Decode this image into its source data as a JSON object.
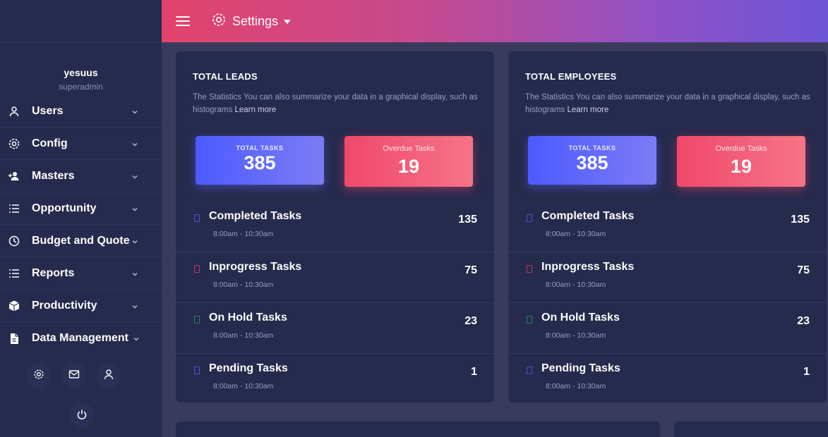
{
  "user": {
    "name": "yesuus",
    "role": "superadmin"
  },
  "sidebar": {
    "items": [
      {
        "label": "Users",
        "icon": "user-icon"
      },
      {
        "label": "Config",
        "icon": "gear-icon"
      },
      {
        "label": "Masters",
        "icon": "user-plus-icon"
      },
      {
        "label": "Opportunity",
        "icon": "list-icon"
      },
      {
        "label": "Budget and Quote",
        "icon": "clock-icon"
      },
      {
        "label": "Reports",
        "icon": "list-icon"
      },
      {
        "label": "Productivity",
        "icon": "cube-icon"
      },
      {
        "label": "Data Management",
        "icon": "file-icon"
      }
    ],
    "bottom_icons": [
      "gear-icon",
      "mail-icon",
      "user-icon",
      "power-icon"
    ]
  },
  "header": {
    "settings_label": "Settings"
  },
  "cards": [
    {
      "title": "TOTAL LEADS",
      "description": "The Statistics You can also summarize your data in a graphical display, such as histograms",
      "learn_more": "Learn more",
      "total_label": "TOTAL TASKS",
      "total_value": "385",
      "overdue_label": "Overdue Tasks",
      "overdue_value": "19",
      "tasks": [
        {
          "name": "Completed Tasks",
          "time": "8:00am - 10:30am",
          "count": "135",
          "color": "#4b54d6"
        },
        {
          "name": "Inprogress Tasks",
          "time": "8:00am - 10:30am",
          "count": "75",
          "color": "#c2365e"
        },
        {
          "name": "On Hold Tasks",
          "time": "8:00am - 10:30am",
          "count": "23",
          "color": "#1f8a5a"
        },
        {
          "name": "Pending Tasks",
          "time": "8:00am - 10:30am",
          "count": "1",
          "color": "#4b54d6"
        }
      ]
    },
    {
      "title": "TOTAL EMPLOYEES",
      "description": "The Statistics You can also summarize your data in a graphical display, such as histograms",
      "learn_more": "Learn more",
      "total_label": "TOTAL TASKS",
      "total_value": "385",
      "overdue_label": "Overdue Tasks",
      "overdue_value": "19",
      "tasks": [
        {
          "name": "Completed Tasks",
          "time": "8:00am - 10:30am",
          "count": "135",
          "color": "#4b54d6"
        },
        {
          "name": "Inprogress Tasks",
          "time": "8:00am - 10:30am",
          "count": "75",
          "color": "#c2365e"
        },
        {
          "name": "On Hold Tasks",
          "time": "8:00am - 10:30am",
          "count": "23",
          "color": "#1f8a5a"
        },
        {
          "name": "Pending Tasks",
          "time": "8:00am - 10:30am",
          "count": "1",
          "color": "#4b54d6"
        }
      ]
    }
  ]
}
